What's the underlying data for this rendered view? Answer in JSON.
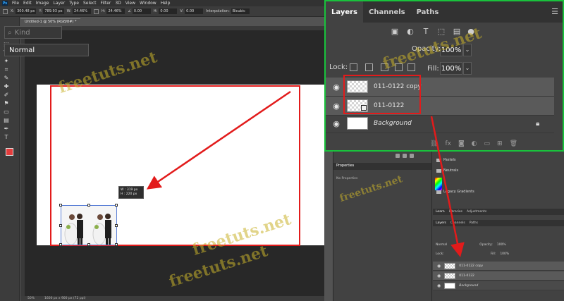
{
  "menubar": {
    "logo": "Ps",
    "items": [
      "File",
      "Edit",
      "Image",
      "Layer",
      "Type",
      "Select",
      "Filter",
      "3D",
      "View",
      "Window",
      "Help"
    ]
  },
  "options": {
    "x_label": "X:",
    "x_value": "300.48 px",
    "y_label": "Y:",
    "y_value": "789.93 px",
    "w_label": "W:",
    "w_value": "24.46%",
    "h_label": "H:",
    "h_value": "24.46%",
    "angle_value": "0.00",
    "h2_value": "0.00",
    "v2_value": "0.00",
    "interp_label": "Interpolation:",
    "interp_value": "Bicubic"
  },
  "document": {
    "tab_title": "Untitled-1 @ 50% (RGB/8#) *",
    "size_tip_w": "W : 319 px",
    "size_tip_h": "H : 220 px"
  },
  "statusbar": {
    "zoom": "50%",
    "docinfo": "1600 px x 900 px (72 ppi)"
  },
  "properties": {
    "tab": "Properties",
    "message": "No Properties"
  },
  "gradients": {
    "items": [
      "Pastels",
      "Neutrals",
      "Legacy Gradients"
    ]
  },
  "small_panel": {
    "tabs_top": [
      "Learn",
      "Libraries",
      "Adjustments"
    ],
    "tabs_layers": [
      "Layers",
      "Channels",
      "Paths"
    ],
    "blend": "Normal",
    "opacity_label": "Opacity:",
    "opacity": "100%",
    "lock_label": "Lock:",
    "fill_label": "Fill:",
    "fill": "100%",
    "layers": [
      "011-0122 copy",
      "011-0122",
      "Background"
    ]
  },
  "layers_panel": {
    "tabs": [
      "Layers",
      "Channels",
      "Paths"
    ],
    "menu_icon": "hamburger-icon",
    "filter_placeholder": "Kind",
    "blend_mode": "Normal",
    "opacity_label": "Opacity:",
    "opacity_value": "100%",
    "lock_label": "Lock:",
    "fill_label": "Fill:",
    "fill_value": "100%",
    "layers": [
      {
        "name": "011-0122 copy",
        "selected": true
      },
      {
        "name": "011-0122",
        "selected": true
      },
      {
        "name": "Background",
        "selected": false
      }
    ]
  },
  "watermark": "freetuts.net",
  "colors": {
    "highlight_red": "#e21b1b",
    "highlight_green": "#19c23c",
    "fg_swatch": "#e43c3c"
  }
}
